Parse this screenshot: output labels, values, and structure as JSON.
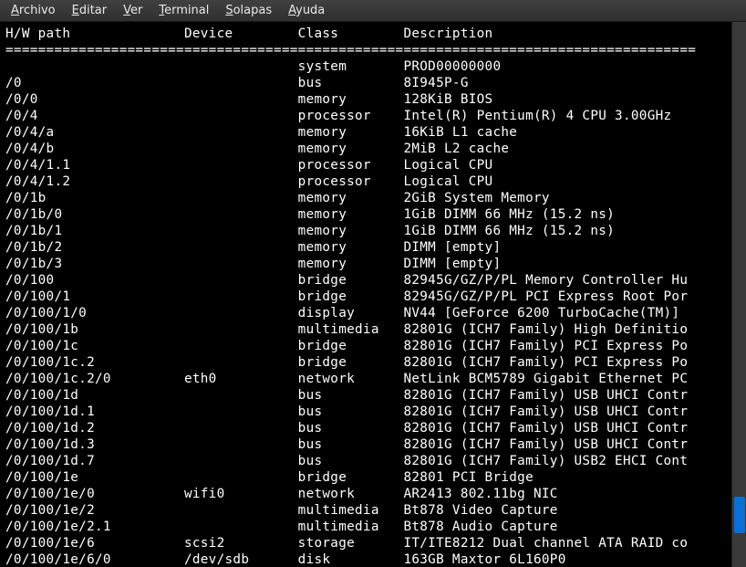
{
  "menu": {
    "items": [
      {
        "label": "Archivo",
        "accel_index": 0
      },
      {
        "label": "Editar",
        "accel_index": 0
      },
      {
        "label": "Ver",
        "accel_index": 0
      },
      {
        "label": "Terminal",
        "accel_index": 0
      },
      {
        "label": "Solapas",
        "accel_index": 0
      },
      {
        "label": "Ayuda",
        "accel_index": 0
      }
    ]
  },
  "terminal": {
    "header": {
      "col1": "H/W path",
      "col2": "Device",
      "col3": "Class",
      "col4": "Description"
    },
    "separator_char": "=",
    "cols": {
      "c1": 22,
      "c2": 14,
      "c3": 13
    },
    "sep_width": 85,
    "rows": [
      {
        "path": "",
        "device": "",
        "class": "system",
        "desc": "PROD00000000"
      },
      {
        "path": "/0",
        "device": "",
        "class": "bus",
        "desc": "8I945P-G"
      },
      {
        "path": "/0/0",
        "device": "",
        "class": "memory",
        "desc": "128KiB BIOS"
      },
      {
        "path": "/0/4",
        "device": "",
        "class": "processor",
        "desc": "Intel(R) Pentium(R) 4 CPU 3.00GHz"
      },
      {
        "path": "/0/4/a",
        "device": "",
        "class": "memory",
        "desc": "16KiB L1 cache"
      },
      {
        "path": "/0/4/b",
        "device": "",
        "class": "memory",
        "desc": "2MiB L2 cache"
      },
      {
        "path": "/0/4/1.1",
        "device": "",
        "class": "processor",
        "desc": "Logical CPU"
      },
      {
        "path": "/0/4/1.2",
        "device": "",
        "class": "processor",
        "desc": "Logical CPU"
      },
      {
        "path": "/0/1b",
        "device": "",
        "class": "memory",
        "desc": "2GiB System Memory"
      },
      {
        "path": "/0/1b/0",
        "device": "",
        "class": "memory",
        "desc": "1GiB DIMM 66 MHz (15.2 ns)"
      },
      {
        "path": "/0/1b/1",
        "device": "",
        "class": "memory",
        "desc": "1GiB DIMM 66 MHz (15.2 ns)"
      },
      {
        "path": "/0/1b/2",
        "device": "",
        "class": "memory",
        "desc": "DIMM [empty]"
      },
      {
        "path": "/0/1b/3",
        "device": "",
        "class": "memory",
        "desc": "DIMM [empty]"
      },
      {
        "path": "/0/100",
        "device": "",
        "class": "bridge",
        "desc": "82945G/GZ/P/PL Memory Controller Hu"
      },
      {
        "path": "/0/100/1",
        "device": "",
        "class": "bridge",
        "desc": "82945G/GZ/P/PL PCI Express Root Por"
      },
      {
        "path": "/0/100/1/0",
        "device": "",
        "class": "display",
        "desc": "NV44 [GeForce 6200 TurboCache(TM)]"
      },
      {
        "path": "/0/100/1b",
        "device": "",
        "class": "multimedia",
        "desc": "82801G (ICH7 Family) High Definitio"
      },
      {
        "path": "/0/100/1c",
        "device": "",
        "class": "bridge",
        "desc": "82801G (ICH7 Family) PCI Express Po"
      },
      {
        "path": "/0/100/1c.2",
        "device": "",
        "class": "bridge",
        "desc": "82801G (ICH7 Family) PCI Express Po"
      },
      {
        "path": "/0/100/1c.2/0",
        "device": "eth0",
        "class": "network",
        "desc": "NetLink BCM5789 Gigabit Ethernet PC"
      },
      {
        "path": "/0/100/1d",
        "device": "",
        "class": "bus",
        "desc": "82801G (ICH7 Family) USB UHCI Contr"
      },
      {
        "path": "/0/100/1d.1",
        "device": "",
        "class": "bus",
        "desc": "82801G (ICH7 Family) USB UHCI Contr"
      },
      {
        "path": "/0/100/1d.2",
        "device": "",
        "class": "bus",
        "desc": "82801G (ICH7 Family) USB UHCI Contr"
      },
      {
        "path": "/0/100/1d.3",
        "device": "",
        "class": "bus",
        "desc": "82801G (ICH7 Family) USB UHCI Contr"
      },
      {
        "path": "/0/100/1d.7",
        "device": "",
        "class": "bus",
        "desc": "82801G (ICH7 Family) USB2 EHCI Cont"
      },
      {
        "path": "/0/100/1e",
        "device": "",
        "class": "bridge",
        "desc": "82801 PCI Bridge"
      },
      {
        "path": "/0/100/1e/0",
        "device": "wifi0",
        "class": "network",
        "desc": "AR2413 802.11bg NIC"
      },
      {
        "path": "/0/100/1e/2",
        "device": "",
        "class": "multimedia",
        "desc": "Bt878 Video Capture"
      },
      {
        "path": "/0/100/1e/2.1",
        "device": "",
        "class": "multimedia",
        "desc": "Bt878 Audio Capture"
      },
      {
        "path": "/0/100/1e/6",
        "device": "scsi2",
        "class": "storage",
        "desc": "IT/ITE8212 Dual channel ATA RAID co"
      },
      {
        "path": "/0/100/1e/6/0",
        "device": "/dev/sdb",
        "class": "disk",
        "desc": "163GB Maxtor 6L160P0"
      }
    ]
  }
}
